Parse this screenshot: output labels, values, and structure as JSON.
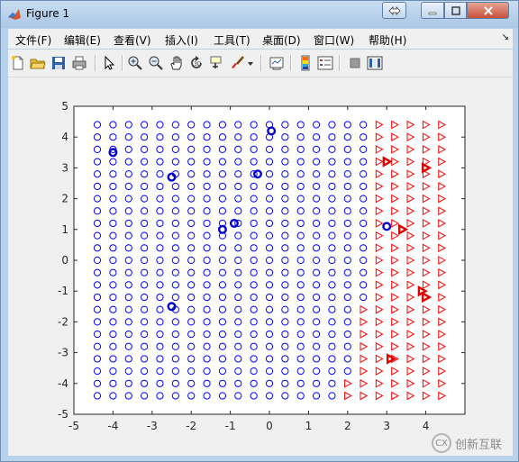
{
  "window": {
    "title": "Figure 1",
    "buttons": {
      "restore_icon": "restore-icon",
      "minimize_icon": "minimize-icon",
      "maximize_icon": "maximize-icon",
      "close_icon": "close-icon"
    }
  },
  "menubar": {
    "items": [
      {
        "label": "文件(F)"
      },
      {
        "label": "编辑(E)"
      },
      {
        "label": "查看(V)"
      },
      {
        "label": "插入(I)"
      },
      {
        "label": "工具(T)"
      },
      {
        "label": "桌面(D)"
      },
      {
        "label": "窗口(W)"
      },
      {
        "label": "帮助(H)"
      }
    ],
    "dock_glyph": "↘"
  },
  "toolbar": {
    "tools": [
      "new-figure-icon",
      "open-file-icon",
      "save-icon",
      "print-icon",
      "edit-plot-arrow-icon",
      "zoom-in-icon",
      "zoom-out-icon",
      "pan-hand-icon",
      "rotate-3d-icon",
      "data-cursor-icon",
      "brush-icon",
      "brush-dropdown-icon",
      "link-plot-icon",
      "colorbar-icon",
      "legend-icon",
      "hide-plot-tools-icon",
      "show-plot-tools-icon"
    ]
  },
  "chart_data": {
    "type": "scatter",
    "xlim": [
      -5,
      5
    ],
    "ylim": [
      -5,
      5
    ],
    "xticks": [
      "-5",
      "-4",
      "-3",
      "-2",
      "-1",
      "0",
      "1",
      "2",
      "3",
      "4"
    ],
    "yticks": [
      "5",
      "4",
      "3",
      "2",
      "1",
      "0",
      "-1",
      "-2",
      "-3",
      "-4",
      "-5"
    ],
    "grid": false,
    "grid_points": {
      "x_min": -4.4,
      "x_max": 4.4,
      "y_min": -4.4,
      "y_max": 4.4,
      "step": 0.4,
      "class_a_marker": "circle",
      "class_b_marker": "triangle-right",
      "boundary_note": "triangles where x is to the right of boundary at each y",
      "boundary_by_row": [
        {
          "y": 4.4,
          "x_from": 2.8
        },
        {
          "y": 4.0,
          "x_from": 2.8
        },
        {
          "y": 3.6,
          "x_from": 2.8
        },
        {
          "y": 3.2,
          "x_from": 2.8
        },
        {
          "y": 2.8,
          "x_from": 2.8
        },
        {
          "y": 2.4,
          "x_from": 2.8
        },
        {
          "y": 2.0,
          "x_from": 2.8
        },
        {
          "y": 1.6,
          "x_from": 2.8
        },
        {
          "y": 1.2,
          "x_from": 2.8
        },
        {
          "y": 0.8,
          "x_from": 2.8
        },
        {
          "y": 0.4,
          "x_from": 2.8
        },
        {
          "y": 0.0,
          "x_from": 2.8
        },
        {
          "y": -0.4,
          "x_from": 2.8
        },
        {
          "y": -0.8,
          "x_from": 2.8
        },
        {
          "y": -1.2,
          "x_from": 2.8
        },
        {
          "y": -1.6,
          "x_from": 2.4
        },
        {
          "y": -2.0,
          "x_from": 2.4
        },
        {
          "y": -2.4,
          "x_from": 2.4
        },
        {
          "y": -2.8,
          "x_from": 2.4
        },
        {
          "y": -3.2,
          "x_from": 2.4
        },
        {
          "y": -3.6,
          "x_from": 2.4
        },
        {
          "y": -4.0,
          "x_from": 2.0
        },
        {
          "y": -4.4,
          "x_from": 2.0
        }
      ]
    },
    "series": [
      {
        "marker": "circle",
        "color": "#0000ff",
        "points": [
          [
            -4.0,
            3.5
          ],
          [
            -2.5,
            2.7
          ],
          [
            -2.5,
            -1.5
          ],
          [
            -1.2,
            1.0
          ],
          [
            -0.9,
            1.2
          ],
          [
            -0.3,
            2.8
          ],
          [
            0.05,
            4.2
          ],
          [
            3.0,
            1.1
          ]
        ]
      },
      {
        "marker": "triangle-right",
        "color": "#ff0000",
        "points": [
          [
            3.0,
            3.2
          ],
          [
            4.0,
            3.0
          ],
          [
            3.4,
            1.0
          ],
          [
            3.9,
            -1.0
          ],
          [
            4.0,
            -1.2
          ],
          [
            3.1,
            -3.2
          ]
        ]
      }
    ],
    "colors": {
      "class_a": "#0000ff",
      "class_b": "#ff0000",
      "class_a_highlight": "#0000cc",
      "class_b_highlight": "#dd0000"
    }
  },
  "watermark": {
    "text": "创新互联",
    "logo_text": "CX"
  }
}
